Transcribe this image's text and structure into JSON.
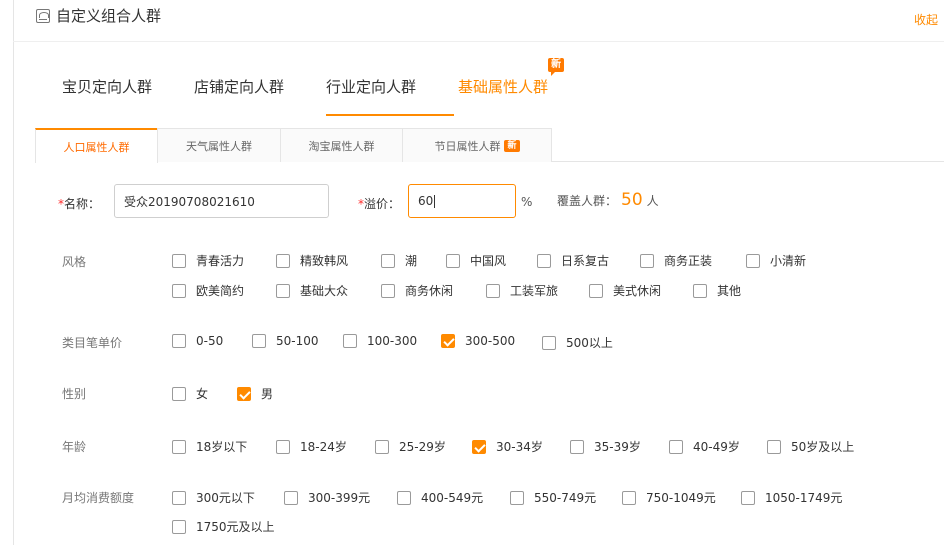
{
  "header": {
    "title": "自定义组合人群",
    "collapse_label": "收起"
  },
  "main_tabs": [
    {
      "label": "宝贝定向人群"
    },
    {
      "label": "店铺定向人群"
    },
    {
      "label": "行业定向人群"
    },
    {
      "label": "基础属性人群",
      "badge": "新",
      "active": true
    }
  ],
  "sub_tabs": [
    {
      "label": "人口属性人群",
      "active": true
    },
    {
      "label": "天气属性人群"
    },
    {
      "label": "淘宝属性人群"
    },
    {
      "label": "节日属性人群",
      "badge": "新"
    }
  ],
  "form": {
    "name_label": "名称：",
    "name_value": "受众20190708021610",
    "premium_label": "溢价：",
    "premium_value": "60",
    "percent_unit": "%",
    "coverage_label": "覆盖人群：",
    "coverage_value": "50",
    "coverage_unit": "人",
    "required_mark": "*"
  },
  "filters": {
    "style": {
      "label": "风格",
      "options": [
        {
          "label": "青春活力",
          "checked": false
        },
        {
          "label": "精致韩风",
          "checked": false
        },
        {
          "label": "潮",
          "checked": false
        },
        {
          "label": "中国风",
          "checked": false
        },
        {
          "label": "日系复古",
          "checked": false
        },
        {
          "label": "商务正装",
          "checked": false
        },
        {
          "label": "小清新",
          "checked": false
        },
        {
          "label": "欧美简约",
          "checked": false
        },
        {
          "label": "基础大众",
          "checked": false
        },
        {
          "label": "商务休闲",
          "checked": false
        },
        {
          "label": "工装军旅",
          "checked": false
        },
        {
          "label": "美式休闲",
          "checked": false
        },
        {
          "label": "其他",
          "checked": false
        }
      ]
    },
    "price": {
      "label": "类目笔单价",
      "options": [
        {
          "label": "0-50",
          "checked": false
        },
        {
          "label": "50-100",
          "checked": false
        },
        {
          "label": "100-300",
          "checked": false
        },
        {
          "label": "300-500",
          "checked": true
        },
        {
          "label": "500以上",
          "checked": false
        }
      ]
    },
    "gender": {
      "label": "性别",
      "options": [
        {
          "label": "女",
          "checked": false
        },
        {
          "label": "男",
          "checked": true
        }
      ]
    },
    "age": {
      "label": "年龄",
      "options": [
        {
          "label": "18岁以下",
          "checked": false
        },
        {
          "label": "18-24岁",
          "checked": false
        },
        {
          "label": "25-29岁",
          "checked": false
        },
        {
          "label": "30-34岁",
          "checked": true
        },
        {
          "label": "35-39岁",
          "checked": false
        },
        {
          "label": "40-49岁",
          "checked": false
        },
        {
          "label": "50岁及以上",
          "checked": false
        }
      ]
    },
    "spend": {
      "label": "月均消费额度",
      "options": [
        {
          "label": "300元以下",
          "checked": false
        },
        {
          "label": "300-399元",
          "checked": false
        },
        {
          "label": "400-549元",
          "checked": false
        },
        {
          "label": "550-749元",
          "checked": false
        },
        {
          "label": "750-1049元",
          "checked": false
        },
        {
          "label": "1050-1749元",
          "checked": false
        },
        {
          "label": "1750元及以上",
          "checked": false
        }
      ]
    }
  },
  "colors": {
    "accent": "#ff8a00",
    "required": "#ff2d2d"
  }
}
